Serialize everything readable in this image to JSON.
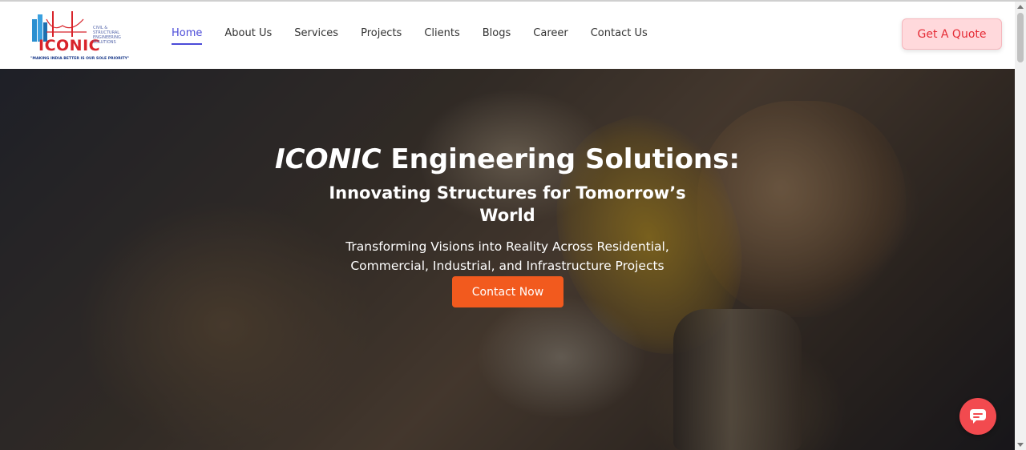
{
  "brand": {
    "logo_word": "ICONIC",
    "logo_subtitle": "CIVIL & STRUCTURAL ENGINEERING SOLUTIONS",
    "logo_tagline": "\"MAKING INDIA BETTER IS OUR SOLE PRIORITY\""
  },
  "nav": {
    "items": [
      {
        "label": "Home"
      },
      {
        "label": "About Us"
      },
      {
        "label": "Services"
      },
      {
        "label": "Projects"
      },
      {
        "label": "Clients"
      },
      {
        "label": "Blogs"
      },
      {
        "label": "Career"
      },
      {
        "label": "Contact Us"
      }
    ],
    "active": "Home"
  },
  "header": {
    "quote_label": "Get A Quote"
  },
  "hero": {
    "title_brand": "ICONIC",
    "title_rest": " Engineering Solutions:",
    "subtitle": "Innovating Structures for Tomorrow’s World",
    "description": "Transforming Visions into Reality Across Residential, Commercial, Industrial, and Infrastructure Projects",
    "cta_label": "Contact Now"
  },
  "chat": {
    "icon": "chat-icon"
  },
  "colors": {
    "accent_nav": "#4b4bd8",
    "quote_bg": "#ffd9dc",
    "quote_text": "#e52b35",
    "cta_bg": "#f25a1e",
    "chat_bg": "#f24a4f"
  }
}
